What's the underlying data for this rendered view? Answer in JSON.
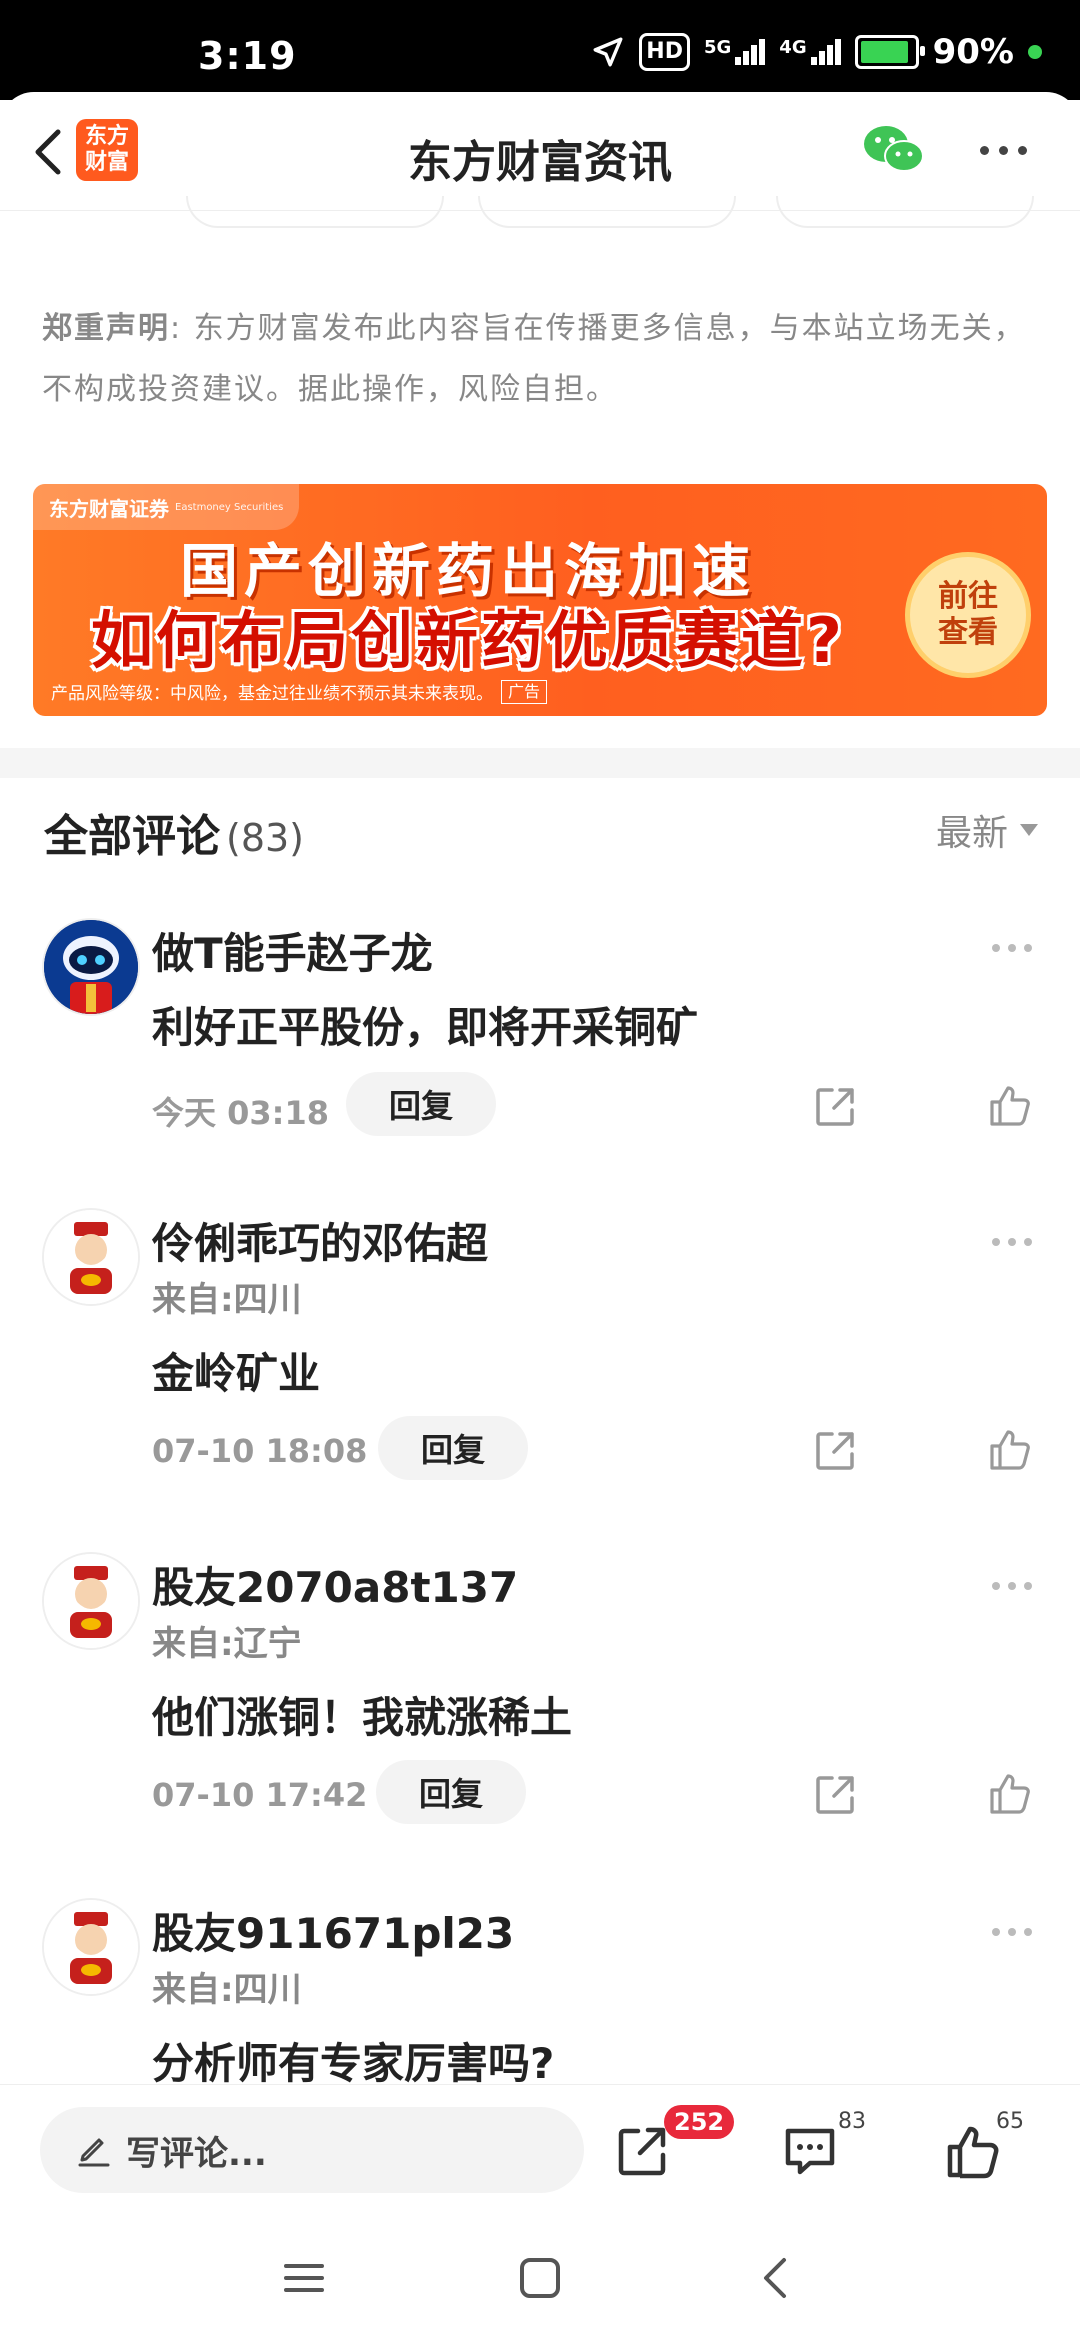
{
  "status_bar": {
    "time": "3:19",
    "hd": "HD",
    "net1": "5G",
    "net2": "4G",
    "battery": "90%",
    "battery_level": 0.9
  },
  "header": {
    "back_icon": "chevron-left-icon",
    "logo_text_1": "东方",
    "logo_text_2": "财富",
    "title": "东方财富资讯",
    "wechat_icon": "wechat-icon",
    "more_icon": "more-dots-icon"
  },
  "disclaimer": {
    "label": "郑重声明",
    "text": ": 东方财富发布此内容旨在传播更多信息，与本站立场无关，不构成投资建议。据此操作，风险自担。"
  },
  "ad": {
    "brand": "东方财富证券",
    "brand_en": "Eastmoney Securities",
    "line1": "国产创新药出海加速",
    "line2": "如何布局创新药优质赛道?",
    "cta_1": "前往",
    "cta_2": "查看",
    "footnote": "产品风险等级：中风险，基金过往业绩不预示其未来表现。",
    "tag": "广告"
  },
  "comments_section": {
    "title": "全部评论",
    "count": "(83)",
    "sort": "最新"
  },
  "comments": [
    {
      "name": "做T能手赵子龙",
      "location": "",
      "text": "利好正平股份，即将开采铜矿",
      "time": "今天 03:18",
      "reply": "回复"
    },
    {
      "name": "伶俐乖巧的邓佑超",
      "location": "来自:四川",
      "text": "金岭矿业",
      "time": "07-10 18:08",
      "reply": "回复"
    },
    {
      "name": "股友2070a8t137",
      "location": "来自:辽宁",
      "text": "他们涨铜！我就涨稀土",
      "time": "07-10 17:42",
      "reply": "回复"
    },
    {
      "name": "股友911671pl23",
      "location": "来自:四川",
      "text": "分析师有专家厉害吗?",
      "time": "",
      "reply": ""
    }
  ],
  "bottom_bar": {
    "placeholder": "写评论...",
    "share_badge": "252",
    "comment_count": "83",
    "like_count": "65"
  },
  "colors": {
    "accent": "#ff5a1e",
    "badge_red": "#e8293b",
    "wechat_green": "#3fc456"
  }
}
